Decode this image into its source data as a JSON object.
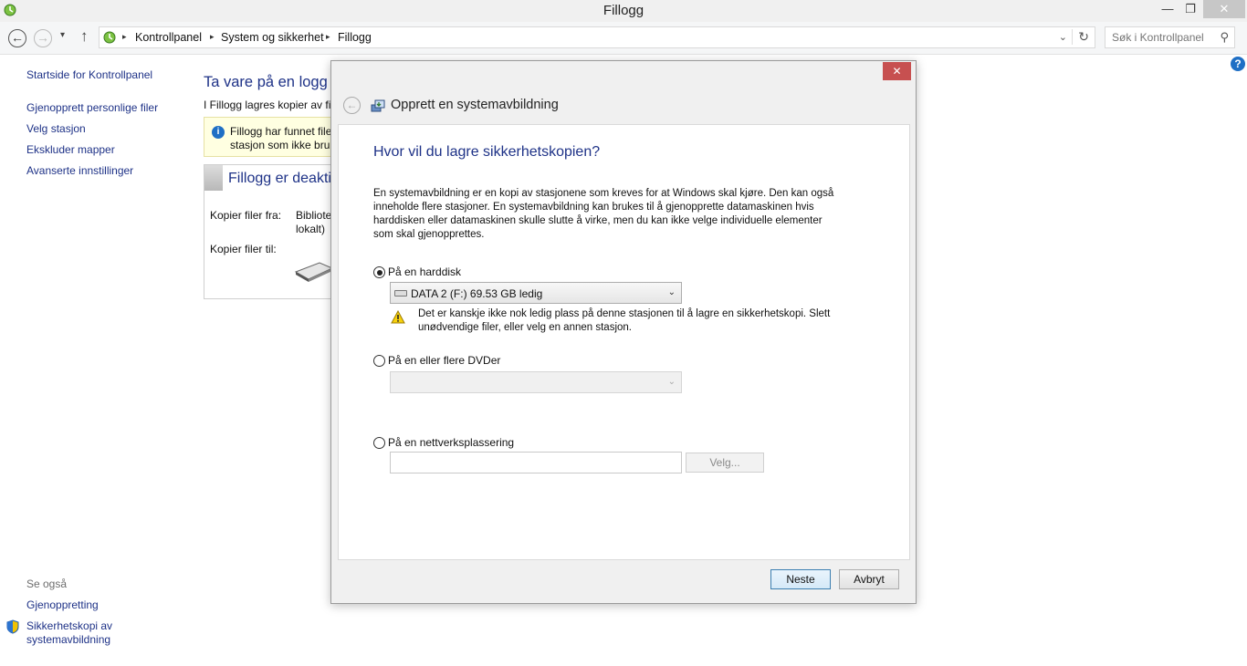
{
  "window": {
    "title": "Fillogg",
    "minimize": "—",
    "maximize": "❐",
    "close": "✕"
  },
  "nav": {
    "back": "←",
    "forward": "→",
    "dropdown": "▾",
    "up": "↑",
    "breadcrumbs": [
      "Kontrollpanel",
      "System og sikkerhet",
      "Fillogg"
    ],
    "breadcrumb_sep": "▸",
    "address_dropdown": "⌄",
    "refresh": "↻",
    "search_placeholder": "Søk i Kontrollpanel",
    "search_icon": "⚲"
  },
  "sidebar": {
    "items": [
      "Startside for Kontrollpanel",
      "Gjenopprett personlige filer",
      "Velg stasjon",
      "Ekskluder mapper",
      "Avanserte innstillinger"
    ],
    "see_also_label": "Se også",
    "see_also_items": [
      "Gjenoppretting",
      "Sikkerhetskopi av",
      "systemavbildning"
    ]
  },
  "help": "?",
  "main": {
    "heading": "Ta vare på en logg o",
    "description": "I Fillogg lagres kopier av fil",
    "info_icon": "i",
    "info_lines": [
      "Fillogg har funnet file",
      "stasjon som ikke bruk"
    ],
    "status_title": "Fillogg er deakti",
    "copy_from_label": "Kopier filer fra:",
    "copy_from_value": [
      "Bibliote",
      "lokalt)"
    ],
    "copy_to_label": "Kopier filer til:"
  },
  "dialog": {
    "close": "✕",
    "back": "←",
    "title": "Opprett en systemavbildning",
    "question": "Hvor vil du lagre sikkerhetskopien?",
    "description_lines": [
      "En systemavbildning er en kopi av stasjonene som kreves for at Windows skal kjøre. Den kan også",
      "inneholde flere stasjoner. En systemavbildning kan brukes til å gjenopprette datamaskinen hvis",
      "harddisken eller datamaskinen skulle slutte å virke, men du kan ikke velge individuelle elementer",
      "som skal gjenopprettes."
    ],
    "option_harddisk": "På en harddisk",
    "harddisk_selected": "DATA 2 (F:)  69.53 GB ledig",
    "select_arrow": "⌄",
    "warning_lines": [
      "Det er kanskje ikke nok ledig plass på denne stasjonen til å lagre en sikkerhetskopi. Slett",
      "unødvendige filer, eller velg en annen stasjon."
    ],
    "option_dvd": "På en eller flere DVDer",
    "option_network": "På en nettverksplassering",
    "network_path_value": "",
    "velg_button": "Velg...",
    "next_button": "Neste",
    "cancel_button": "Avbryt",
    "selected_option": "harddisk"
  }
}
